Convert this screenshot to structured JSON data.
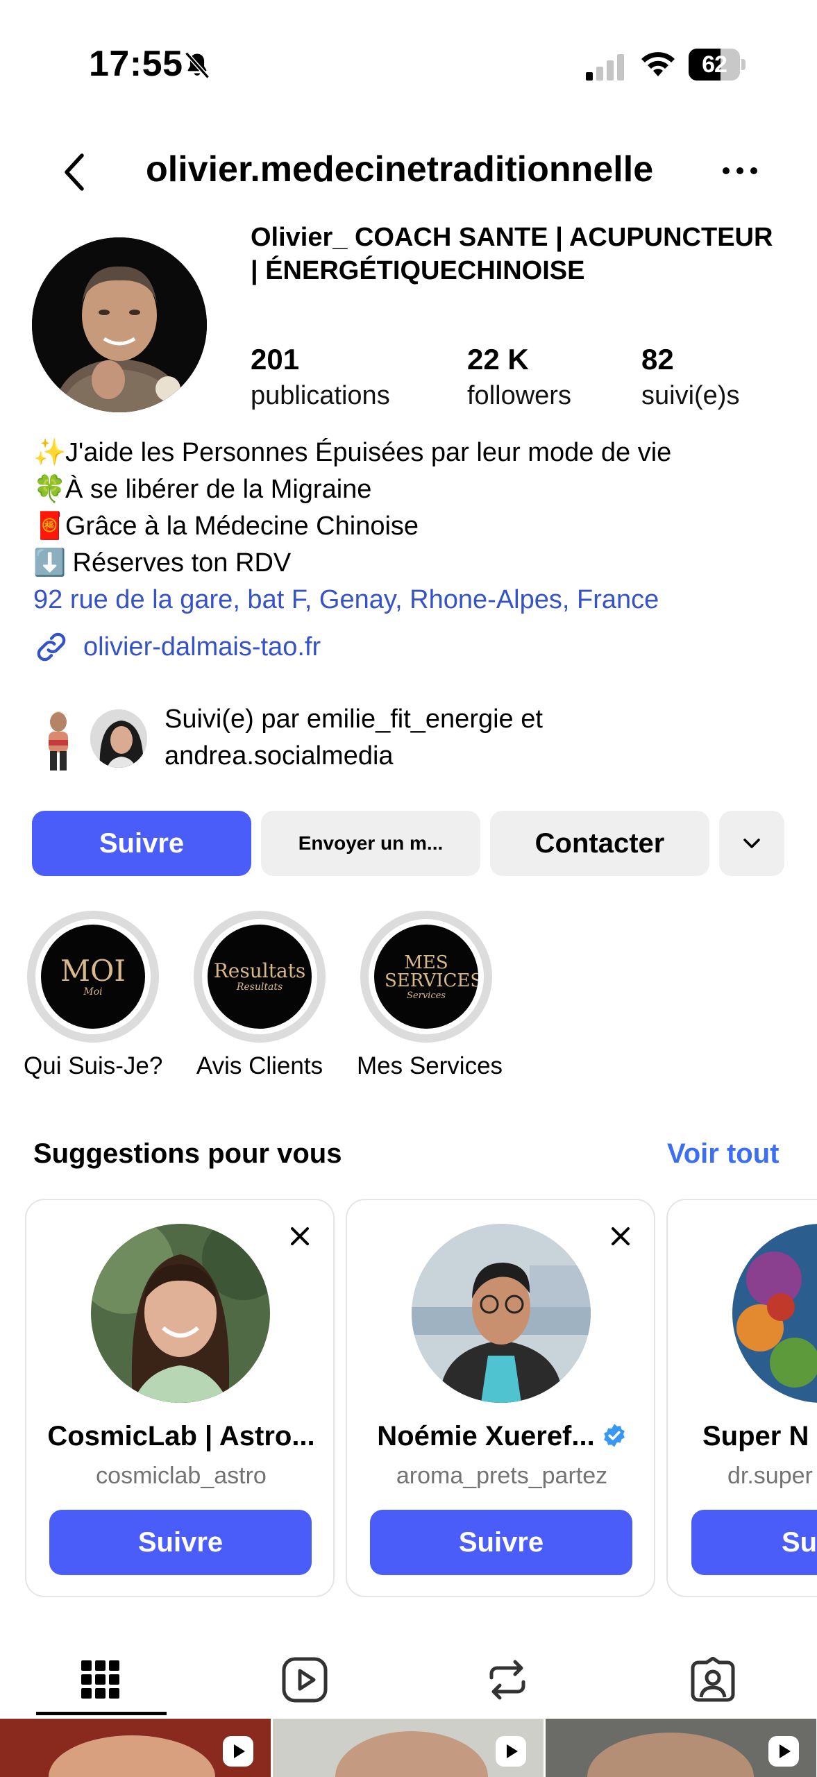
{
  "status_bar": {
    "time": "17:55",
    "battery": "62",
    "battery_level": 0.62
  },
  "header": {
    "username": "olivier.medecinetraditionnelle"
  },
  "profile": {
    "full_name": "Olivier_ COACH SANTE | ACUPUNCTEUR | ÉNERGÉTIQUECHINOISE",
    "stats": [
      {
        "value": "201",
        "label": "publications"
      },
      {
        "value": "22 K",
        "label": "followers"
      },
      {
        "value": "82",
        "label": "suivi(e)s"
      }
    ],
    "bio": [
      {
        "emoji": "✨",
        "text": "J'aide les Personnes Épuisées par leur mode de vie"
      },
      {
        "emoji": "🍀",
        "text": "À se libérer de la Migraine"
      },
      {
        "emoji": "🧧",
        "text": "Grâce à la Médecine Chinoise"
      },
      {
        "emoji": "⬇️",
        "text": " Réserves ton RDV"
      }
    ],
    "address": "92 rue de la gare, bat F, Genay, Rhone-Alpes, France",
    "link": "olivier-dalmais-tao.fr",
    "followed_by": "Suivi(e) par emilie_fit_energie et andrea.socialmedia"
  },
  "actions": {
    "follow": "Suivre",
    "message": "Envoyer un m...",
    "contact": "Contacter"
  },
  "highlights": [
    {
      "label": "Qui Suis-Je?",
      "cover_text": "MOI",
      "cover_sub": "Moi"
    },
    {
      "label": "Avis Clients",
      "cover_text": "Resultats",
      "cover_sub": "Resultats"
    },
    {
      "label": "Mes Services",
      "cover_text": "MES SERVICES",
      "cover_sub": "Services"
    }
  ],
  "suggestions": {
    "title": "Suggestions pour vous",
    "see_all": "Voir tout",
    "cards": [
      {
        "name": "CosmicLab | Astro...",
        "handle": "cosmiclab_astro",
        "button": "Suivre",
        "verified": false
      },
      {
        "name": "Noémie Xueref...",
        "handle": "aroma_prets_partez",
        "button": "Suivre",
        "verified": true
      },
      {
        "name": "Super N",
        "handle": "dr.super",
        "button": "Sui",
        "verified": false
      }
    ]
  },
  "tabs": [
    "grid-icon",
    "reels-icon",
    "reposts-icon",
    "tagged-icon"
  ],
  "colors": {
    "accent_button": "#4a5df9",
    "link": "#3652c7",
    "see_all": "#3b6ef0",
    "verified": "#3897f0"
  }
}
